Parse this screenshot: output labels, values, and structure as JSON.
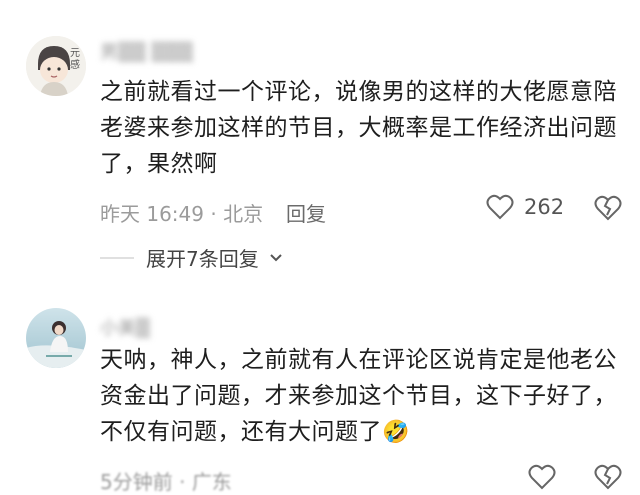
{
  "comments": [
    {
      "username": "男▒▒ ▒▒▒",
      "avatar_text": "元感",
      "body": "之前就看过一个评论，说像男的这样的大佬愿意陪老婆来参加这样的节目，大概率是工作经济出问题了，果然啊",
      "time": "昨天 16:49",
      "location": "北京",
      "reply_label": "回复",
      "likes": "262",
      "expand_label": "展开7条回复"
    },
    {
      "username": "小美▒",
      "body": "天呐，神人，之前就有人在评论区说肯定是他老公资金出了问题，才来参加这个节目，这下子好了，不仅有问题，还有大问题了",
      "emoji": "🤣",
      "time": "5分钟前",
      "location": "广东"
    }
  ],
  "meta_separator": "·",
  "icons": {
    "like": "heart-outline-icon",
    "dislike": "broken-heart-icon",
    "expand": "chevron-down-icon"
  },
  "colors": {
    "text": "#1e1e1e",
    "meta": "#9b9b9b",
    "icon": "#666666"
  }
}
